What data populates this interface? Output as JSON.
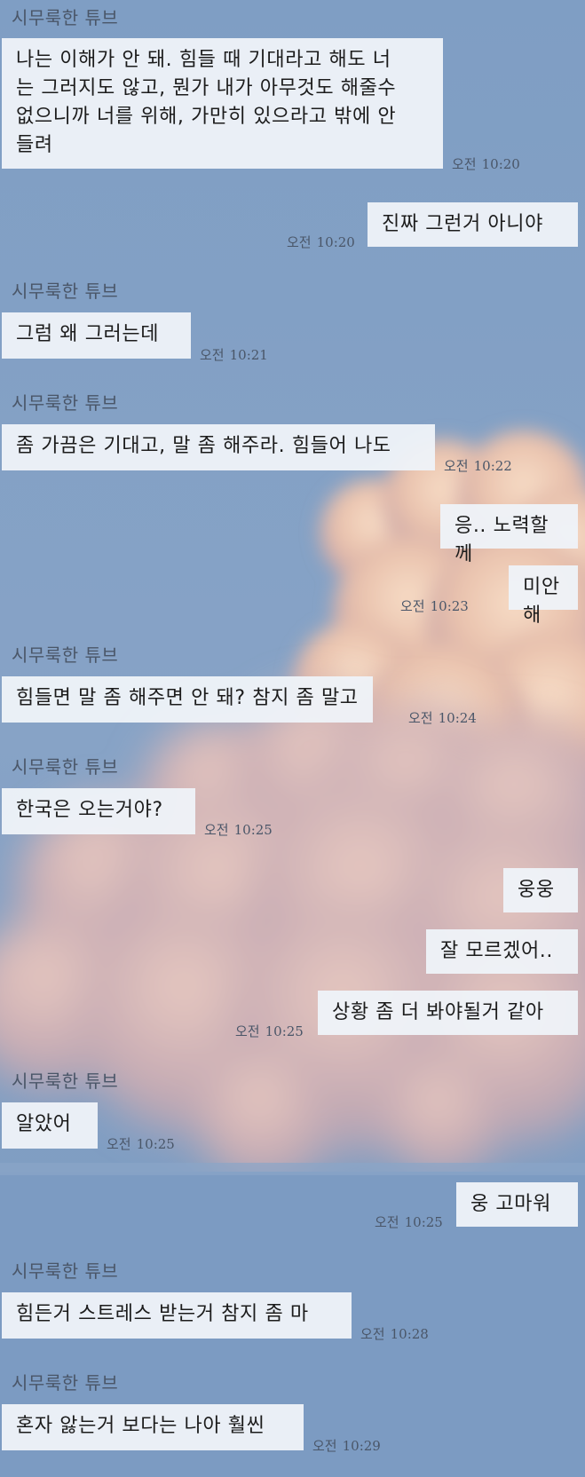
{
  "sender_name": "시무룩한 튜브",
  "ampm": "오전",
  "messages": [
    {
      "text": "나는 이해가 안 돼. 힘들 때 기대라고 해도 너\n는 그러지도 않고, 뭔가 내가 아무것도 해줄수\n없으니까 너를 위해, 가만히 있으라고 밖에 안\n들려",
      "time": "10:20"
    },
    {
      "text": "진짜 그런거 아니야",
      "time": "10:20"
    },
    {
      "text": "그럼 왜 그러는데",
      "time": "10:21"
    },
    {
      "text": "좀 가끔은 기대고, 말 좀 해주라. 힘들어 나도",
      "time": "10:22"
    },
    {
      "text": "응.. 노력할께"
    },
    {
      "text": "미안해",
      "time": "10:23"
    },
    {
      "text": "힘들면 말 좀 해주면 안 돼? 참지 좀 말고",
      "time": "10:24"
    },
    {
      "text": "한국은 오는거야?",
      "time": "10:25"
    },
    {
      "text": "웅웅"
    },
    {
      "text": "잘 모르겠어.."
    },
    {
      "text": "상황 좀 더 봐야될거 같아",
      "time": "10:25"
    },
    {
      "text": "알았어",
      "time": "10:25"
    },
    {
      "text": "웅 고마워",
      "time": "10:25"
    },
    {
      "text": "힘든거 스트레스 받는거 참지 좀 마",
      "time": "10:28"
    },
    {
      "text": "혼자 앓는거 보다는 나아 훨씬",
      "time": "10:29"
    }
  ]
}
